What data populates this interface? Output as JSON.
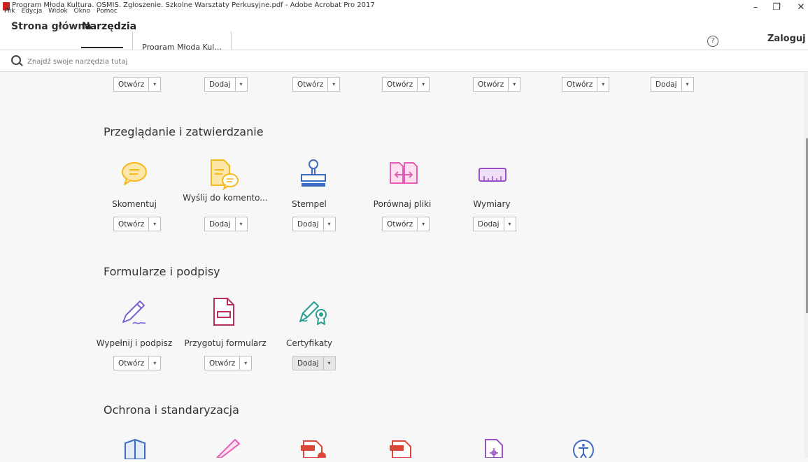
{
  "window": {
    "title": "Program Młoda Kultura. OSMIS. Zgłoszenie. Szkolne Warsztaty Perkusyjne.pdf - Adobe Acrobat Pro 2017",
    "menu": [
      "Plik",
      "Edycja",
      "Widok",
      "Okno",
      "Pomoc"
    ],
    "minimize": "–",
    "maximize": "❐",
    "close": "✕"
  },
  "tabs": {
    "home": "Strona główna",
    "tools": "Narzędzia",
    "document": "Program Młoda Kul...",
    "help": "?",
    "login": "Zaloguj si"
  },
  "search": {
    "placeholder": "Znajdź swoje narzędzia tutaj"
  },
  "top_row": [
    "Otwórz",
    "Dodaj",
    "Otwórz",
    "Otwórz",
    "Otwórz",
    "Otwórz",
    "Dodaj"
  ],
  "sections": [
    {
      "title": "Przeglądanie i zatwierdzanie",
      "tools": [
        {
          "label": "Skomentuj",
          "action": "Otwórz",
          "icon": "comment-icon"
        },
        {
          "label": "Wyślij do komento...",
          "action": "Dodaj",
          "icon": "send-for-comments-icon"
        },
        {
          "label": "Stempel",
          "action": "Dodaj",
          "icon": "stamp-icon"
        },
        {
          "label": "Porównaj pliki",
          "action": "Otwórz",
          "icon": "compare-files-icon"
        },
        {
          "label": "Wymiary",
          "action": "Dodaj",
          "icon": "measure-icon"
        }
      ]
    },
    {
      "title": "Formularze i podpisy",
      "tools": [
        {
          "label": "Wypełnij i podpisz",
          "action": "Otwórz",
          "icon": "fill-sign-icon"
        },
        {
          "label": "Przygotuj formularz",
          "action": "Otwórz",
          "icon": "prepare-form-icon"
        },
        {
          "label": "Certyfikaty",
          "action": "Dodaj",
          "icon": "certificates-icon"
        }
      ]
    },
    {
      "title": "Ochrona i standaryzacja",
      "tools": []
    }
  ]
}
